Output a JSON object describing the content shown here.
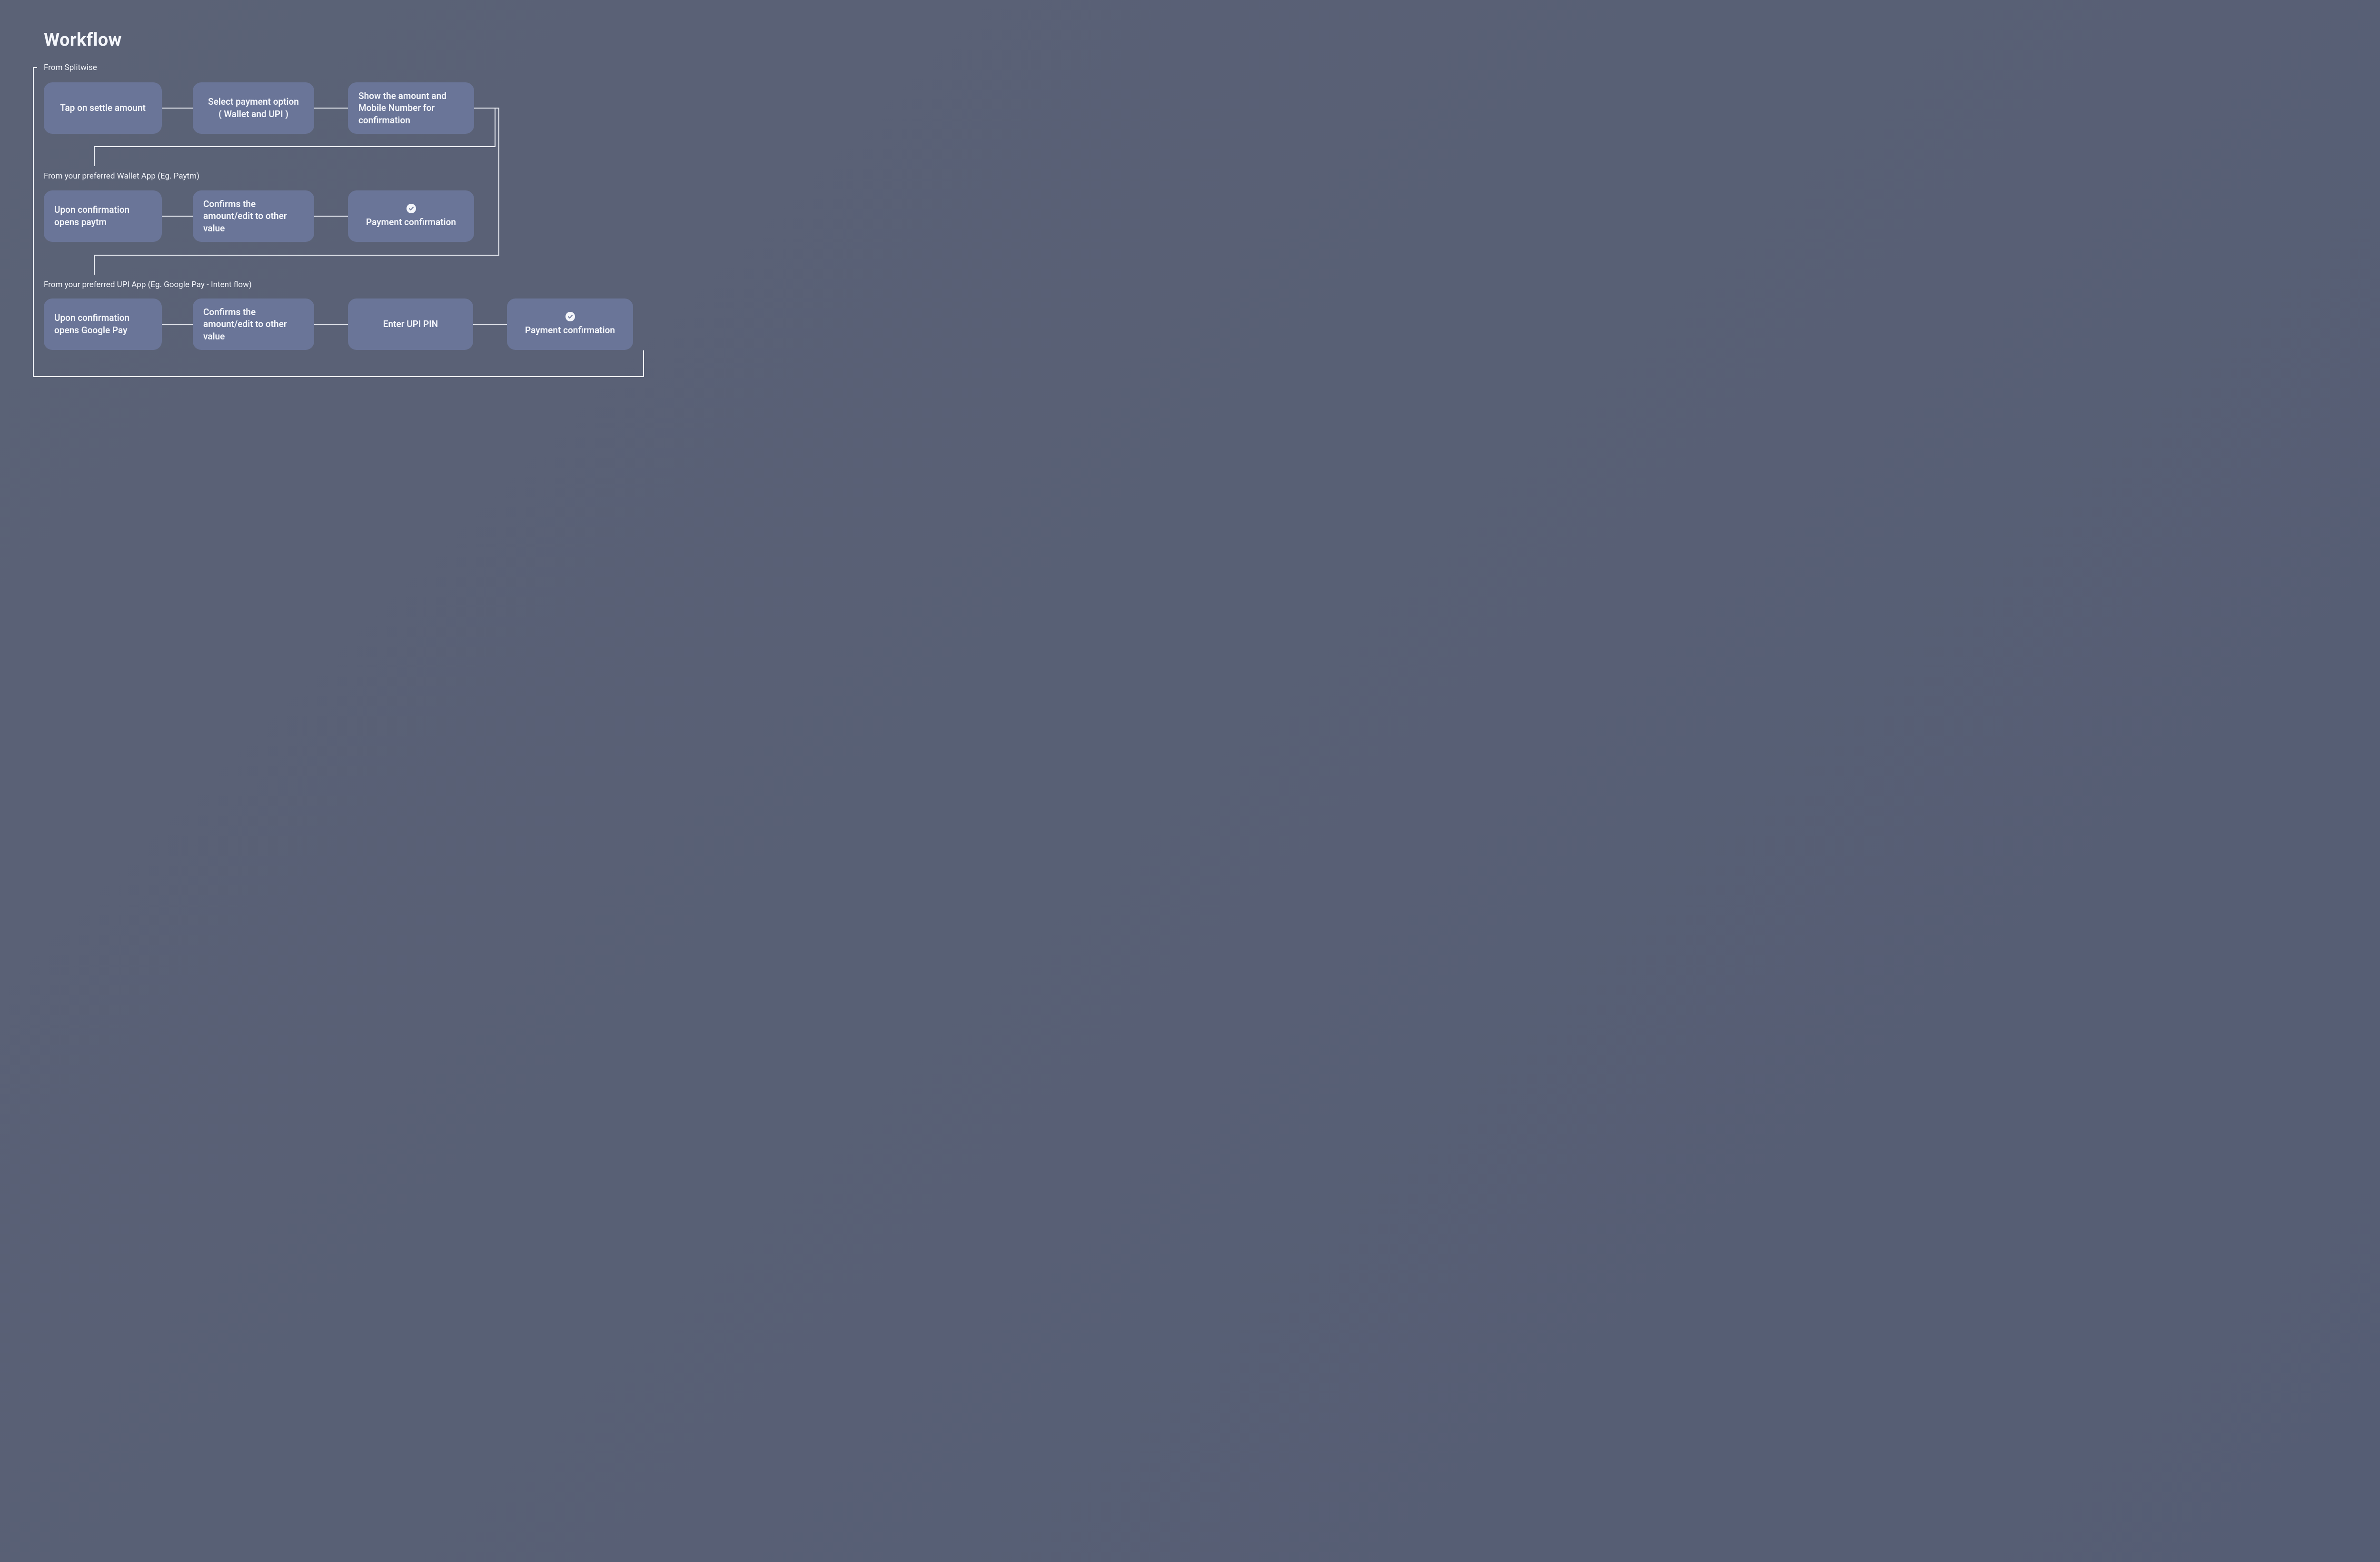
{
  "title": "Workflow",
  "groups": {
    "g1": {
      "label": "From Splitwise"
    },
    "g2": {
      "label": "From your preferred Wallet App (Eg. Paytm)"
    },
    "g3": {
      "label": "From your preferred UPI App (Eg. Google Pay - Intent flow)"
    }
  },
  "nodes": {
    "n1": {
      "text": "Tap on settle amount"
    },
    "n2": {
      "line1": "Select payment option",
      "line2": "( Wallet and UPI )"
    },
    "n3": {
      "text": "Show  the  amount and Mobile Number  for confirmation"
    },
    "n4": {
      "text": "Upon confirmation opens paytm"
    },
    "n5": {
      "text": "Confirms the amount/edit to other value"
    },
    "n6": {
      "text": "Payment confirmation"
    },
    "n7": {
      "text": "Upon confirmation opens Google Pay"
    },
    "n8": {
      "text": "Confirms the amount/edit to other value"
    },
    "n9": {
      "text": "Enter UPI PIN"
    },
    "n10": {
      "text": "Payment confirmation"
    }
  }
}
